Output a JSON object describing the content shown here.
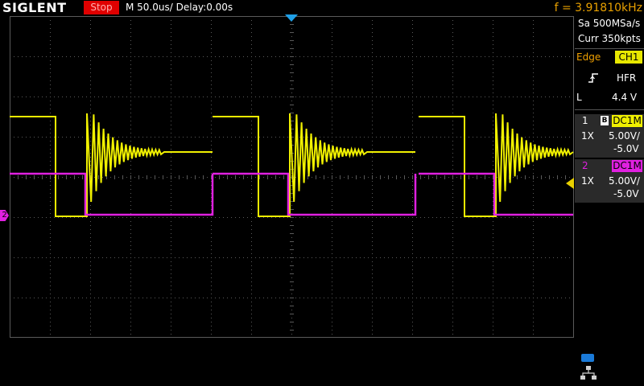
{
  "header": {
    "brand": "SIGLENT",
    "run_state": "Stop",
    "timebase": "M 50.0us/",
    "delay": "Delay:0.00s",
    "frequency": "f = 3.91810kHz"
  },
  "acquisition": {
    "sample_rate": "Sa 500MSa/s",
    "memory_depth": "Curr 350kpts"
  },
  "trigger": {
    "type_label": "Edge",
    "source": "CH1",
    "coupling": "HFR",
    "level_label": "L",
    "level": "4.4 V",
    "slope_icon": "rising-edge-icon"
  },
  "channels": [
    {
      "number": "1",
      "coupling": "DC1M",
      "probe": "1X",
      "scale": "5.00V/",
      "offset": "-5.0V",
      "color": "#f0f000"
    },
    {
      "number": "2",
      "coupling": "DC1M",
      "probe": "1X",
      "scale": "5.00V/",
      "offset": "-5.0V",
      "color": "#e020e0"
    }
  ],
  "markers": {
    "ch2_ground": "2"
  },
  "status_icons": [
    "usb-icon",
    "network-icon"
  ],
  "colors": {
    "ch1": "#f0f000",
    "ch2": "#e020e0",
    "trigger_position": "#1fa0e8",
    "stop_bg": "#e00000",
    "frequency_text": "#e8a000",
    "grid": "#5a5a5a"
  }
}
